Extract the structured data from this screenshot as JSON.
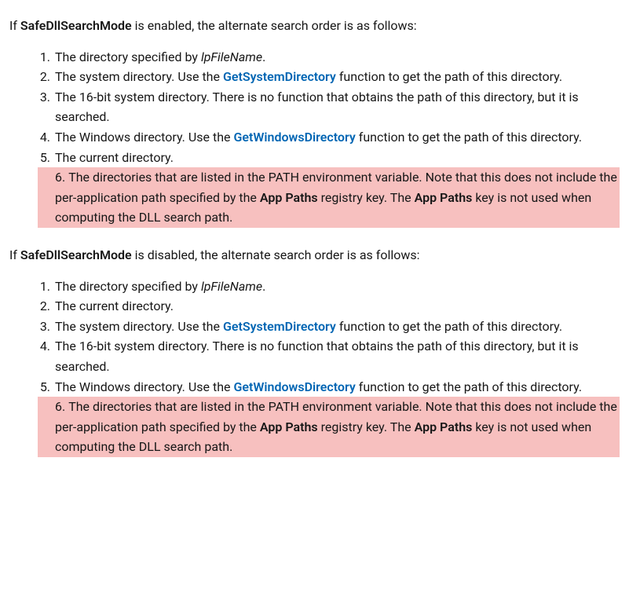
{
  "section1": {
    "intro_prefix": "If ",
    "intro_bold": "SafeDllSearchMode",
    "intro_suffix": " is enabled, the alternate search order is as follows:",
    "items": [
      {
        "pre": "The directory specified by ",
        "italic": "lpFileName",
        "post": "."
      },
      {
        "pre": "The system directory. Use the ",
        "link": "GetSystemDirectory",
        "post": " function to get the path of this directory."
      },
      {
        "text": "The 16-bit system directory. There is no function that obtains the path of this directory, but it is searched."
      },
      {
        "pre": "The Windows directory. Use the ",
        "link": "GetWindowsDirectory",
        "post": " function to get the path of this directory."
      },
      {
        "text": "The current directory."
      },
      {
        "hl_pre": "The directories that are listed in the PATH environment variable. Note that this does not include the per-application path specified by the ",
        "hl_b1": "App Paths",
        "hl_mid": " registry key. The ",
        "hl_b2": "App Paths",
        "hl_post": " key is not used when computing the DLL search path."
      }
    ]
  },
  "section2": {
    "intro_prefix": "If ",
    "intro_bold": "SafeDllSearchMode",
    "intro_suffix": " is disabled, the alternate search order is as follows:",
    "items": [
      {
        "pre": "The directory specified by ",
        "italic": "lpFileName",
        "post": "."
      },
      {
        "text": "The current directory."
      },
      {
        "pre": "The system directory. Use the ",
        "link": "GetSystemDirectory",
        "post": " function to get the path of this directory."
      },
      {
        "text": "The 16-bit system directory. There is no function that obtains the path of this directory, but it is searched."
      },
      {
        "pre": "The Windows directory. Use the ",
        "link": "GetWindowsDirectory",
        "post": " function to get the path of this directory."
      },
      {
        "hl_pre": "The directories that are listed in the PATH environment variable. Note that this does not include the per-application path specified by the ",
        "hl_b1": "App Paths",
        "hl_mid": " registry key. The ",
        "hl_b2": "App Paths",
        "hl_post": " key is not used when computing the DLL search path."
      }
    ]
  }
}
